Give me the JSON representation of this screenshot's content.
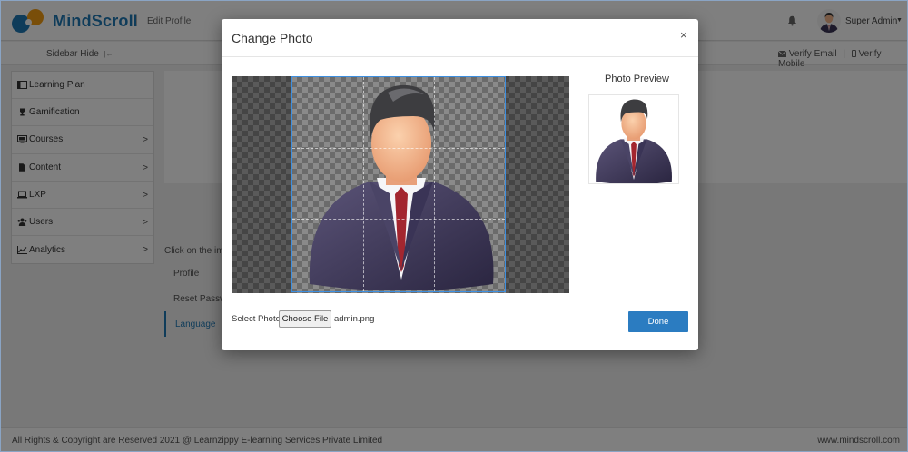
{
  "header": {
    "brand": "MindScroll",
    "separator": "|",
    "breadcrumb": "Edit Profile",
    "user_name": "Super Admin",
    "caret": "▼"
  },
  "subbar": {
    "sidebar_hide": "Sidebar Hide",
    "sidebar_hide_icon": "|←",
    "verify_email": "Verify Email",
    "divider": "|",
    "verify_mobile": "Verify Mobile"
  },
  "sidebar": {
    "items": [
      {
        "label": "Learning Plan",
        "icon": "book-icon",
        "has_chevron": false
      },
      {
        "label": "Gamification",
        "icon": "trophy-icon",
        "has_chevron": false
      },
      {
        "label": "Courses",
        "icon": "monitor-icon",
        "has_chevron": true
      },
      {
        "label": "Content",
        "icon": "file-icon",
        "has_chevron": true
      },
      {
        "label": "LXP",
        "icon": "laptop-icon",
        "has_chevron": true
      },
      {
        "label": "Users",
        "icon": "users-icon",
        "has_chevron": true
      },
      {
        "label": "Analytics",
        "icon": "chart-icon",
        "has_chevron": true
      }
    ],
    "chevron": ">"
  },
  "profile": {
    "click_text": "Click on the ima",
    "tabs": [
      "Profile",
      "Reset Passwo",
      "Language"
    ],
    "active_tab": "Language"
  },
  "footer": {
    "copyright": "All Rights & Copyright are Reserved 2021 @ Learnzippy E-learning Services Private Limited",
    "site": "www.mindscroll.com"
  },
  "modal": {
    "title": "Change Photo",
    "close": "×",
    "preview_label": "Photo Preview",
    "select_label": "Select Photo",
    "choose_file": "Choose File",
    "file_name": "admin.png",
    "done": "Done"
  },
  "colors": {
    "brand_blue": "#1f78b4",
    "brand_orange": "#f39c12",
    "primary_button": "#2b7cc1",
    "crop_border": "#3d8fe0"
  }
}
